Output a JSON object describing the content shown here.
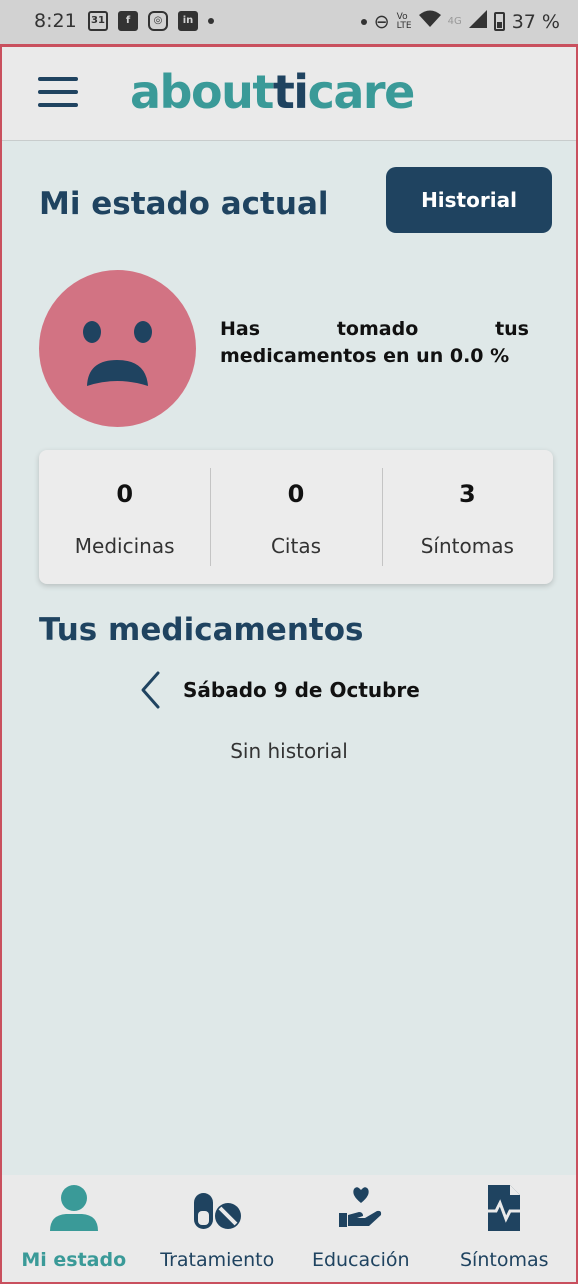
{
  "status_bar": {
    "time": "8:21",
    "calendar_day": "31",
    "battery": "37 %",
    "network": "4G"
  },
  "app": {
    "logo_prefix": "about",
    "logo_ti": "ti",
    "logo_suffix": "care"
  },
  "state": {
    "title": "Mi estado actual",
    "history_button": "Historial",
    "mood": "sad",
    "message_words": [
      "Has",
      "tomado",
      "tus"
    ],
    "message_line2": "medicamentos en un 0.0 %",
    "percentage_taken": 0.0
  },
  "stats": [
    {
      "value": "0",
      "label": "Medicinas"
    },
    {
      "value": "0",
      "label": "Citas"
    },
    {
      "value": "3",
      "label": "Síntomas"
    }
  ],
  "medications": {
    "title": "Tus medicamentos",
    "date": "Sábado 9 de Octubre",
    "empty": "Sin historial"
  },
  "bottom_nav": [
    {
      "label": "Mi estado",
      "icon": "person-icon",
      "active": true
    },
    {
      "label": "Tratamiento",
      "icon": "pills-icon",
      "active": false
    },
    {
      "label": "Educación",
      "icon": "hand-heart-icon",
      "active": false
    },
    {
      "label": "Síntomas",
      "icon": "medical-file-icon",
      "active": false
    }
  ],
  "colors": {
    "primary": "#1f4360",
    "accent": "#3a9a98",
    "face": "#d27383",
    "background": "#dfe8e8"
  }
}
